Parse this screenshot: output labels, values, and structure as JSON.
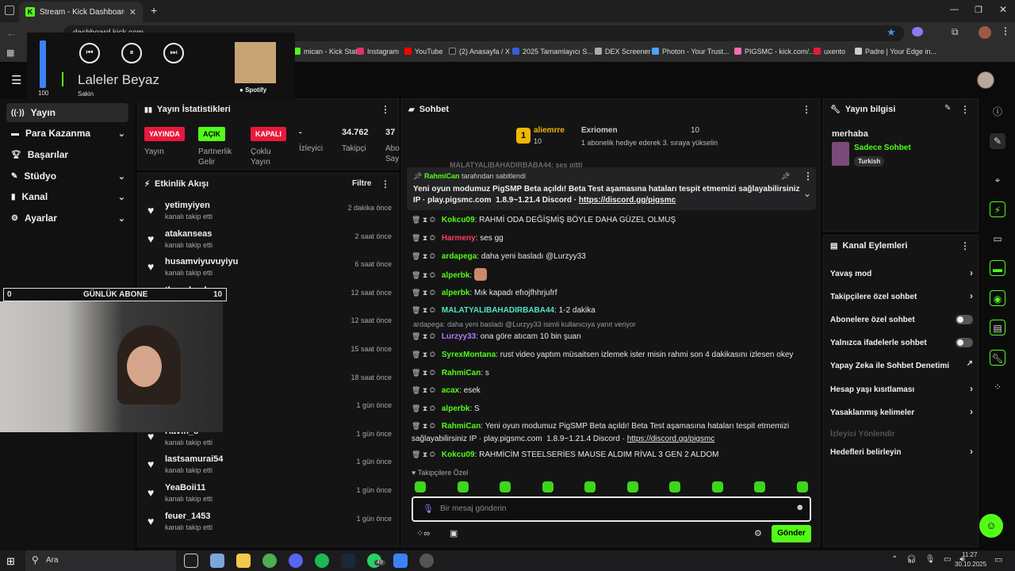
{
  "browser": {
    "tab_title": "Stream - Kick Dashboard",
    "address": "dashboard.kick.com",
    "bookmarks": [
      "mican - Kick Stat...",
      "Instagram",
      "YouTube",
      "(2) Anasayfa / X",
      "2025 Tamamlayıcı S...",
      "DEX Screener",
      "Photon - Your Trust...",
      "PIGSMC - kick.com/...",
      "uxento",
      "Padre | Your Edge in..."
    ]
  },
  "sidebar": {
    "items": [
      {
        "label": "Yayın",
        "active": true
      },
      {
        "label": "Para Kazanma",
        "chevron": true
      },
      {
        "label": "Başarılar"
      },
      {
        "label": "Stüdyo",
        "chevron": true
      },
      {
        "label": "Kanal",
        "chevron": true
      },
      {
        "label": "Ayarlar",
        "chevron": true
      }
    ]
  },
  "stats": {
    "title": "Yayın İstatistikleri",
    "badges": [
      {
        "text": "YAYINDA",
        "color": "#e8193c",
        "label": "Yayın"
      },
      {
        "text": "AÇIK",
        "color": "#53fc18",
        "label": "Partnerlik Gelir"
      },
      {
        "text": "KAPALI",
        "color": "#e8193c",
        "label": "Çoklu Yayın"
      }
    ],
    "numbers": [
      {
        "value": "-",
        "label": "İzleyici"
      },
      {
        "value": "34.762",
        "label": "Takipçi"
      },
      {
        "value": "37",
        "label": "Abo Say"
      }
    ]
  },
  "activity": {
    "title": "Etkinlik Akışı",
    "filter": "Filtre",
    "items": [
      {
        "name": "yetimyiyen",
        "sub": "kanalı takip etti",
        "time": "2 dakika önce"
      },
      {
        "name": "atakanseas",
        "sub": "kanalı takip etti",
        "time": "2 saat önce"
      },
      {
        "name": "husamviyuvuyiyu",
        "sub": "kanalı takip etti",
        "time": "6 saat önce"
      },
      {
        "name": "throwbanlama",
        "sub": "kanalı takip etti",
        "time": "12 saat önce"
      },
      {
        "name": "",
        "sub": "",
        "time": "12 saat önce"
      },
      {
        "name": "7",
        "sub": "",
        "time": "15 saat önce"
      },
      {
        "name": "",
        "sub": "",
        "time": "18 saat önce"
      },
      {
        "name": "",
        "sub": "",
        "time": "1 gün önce"
      },
      {
        "name": "Havin_8",
        "sub": "kanalı takip etti",
        "time": "1 gün önce"
      },
      {
        "name": "lastsamurai54",
        "sub": "kanalı takip etti",
        "time": "1 gün önce"
      },
      {
        "name": "YeaBoii11",
        "sub": "kanalı takip etti",
        "time": "1 gün önce"
      },
      {
        "name": "feuer_1453",
        "sub": "kanalı takip etti",
        "time": "1 gün önce"
      }
    ]
  },
  "chat": {
    "title": "Sohbet",
    "top_user": "aliemrre",
    "top_count": "10",
    "top_rank": "1",
    "exriomen": "Exriomen",
    "exriomen_count": "10",
    "gift_note": "1 abonelik hediye ederek 3. sıraya yükselin",
    "pinned": {
      "by": "RahmiCan",
      "by_suffix": "tarafından sabitlendi",
      "text": "Yeni oyun modumuz PigSMP Beta açıldı! Beta Test aşamasına hataları tespit etmemizi sağlayabilirsiniz IP · play.pigsmc.com",
      "version": "1.8.9~1.21.4 Discord ·",
      "link": "https://discord.gg/pigsmc"
    },
    "faded": "MALATYALIBAHADIRBABA44: ses gitti",
    "messages": [
      {
        "user": "Kokcu09",
        "cls": "g",
        "text": "RAHMİ ODA DEĞİŞMİŞ BÖYLE DAHA GÜZEL OLMUŞ"
      },
      {
        "user": "Harmeny",
        "cls": "r",
        "text": "ses gg"
      },
      {
        "user": "ardapega",
        "cls": "g",
        "text": "daha yeni basladı @Lurzyy33"
      },
      {
        "user": "alperbk",
        "cls": "g",
        "text": ""
      },
      {
        "user": "alperbk",
        "cls": "g",
        "text": "Mık kapadı efıojfhhrjufrf"
      },
      {
        "user": "MALATYALIBAHADIRBABA44",
        "cls": "c",
        "text": "1-2 dakika"
      },
      {
        "user": "Lurzyy33",
        "cls": "p",
        "text": "ona göre atıcam 10 bin şuan"
      },
      {
        "user": "SyrexMontana",
        "cls": "g",
        "text": "rust video yaptım müsaitsen izlemek ister misin rahmi son 4 dakikasını izlesen okey"
      },
      {
        "user": "RahmiCan",
        "cls": "g",
        "text": "s"
      },
      {
        "user": "acax",
        "cls": "g",
        "text": "esek"
      },
      {
        "user": "alperbk",
        "cls": "g",
        "text": "S"
      }
    ],
    "reply_note": "ardapega: daha yeni basladı @Lurzyy33 isimli kullanıcıya yanıt veriyor",
    "long_msg": {
      "user": "RahmiCan",
      "text": "Yeni oyun modumuz PigSMP Beta açıldı! Beta Test aşamasına hataları tespit etmemizi sağlayabilirsiniz IP · play.pigsmc.com",
      "version": "1.8.9~1.21.4 Discord ·",
      "link": "https://discord.gg/pigsmc"
    },
    "last_msg": {
      "user": "Kokcu09",
      "text": "RAHMİCİM STEELSERİES MAUSE ALDIM RİVAL 3 GEN 2 ALDOM"
    },
    "followers_only": "Takipçilere Özel",
    "placeholder": "Bir mesaj gönderin",
    "send": "Gönder"
  },
  "stream_info": {
    "title": "Yayın bilgisi",
    "stream_title": "merhaba",
    "category": "Sadece Sohbet",
    "tag": "Turkish"
  },
  "channel_actions": {
    "title": "Kanal Eylemleri",
    "items": [
      {
        "label": "Yavaş mod",
        "type": "arrow"
      },
      {
        "label": "Takipçilere özel sohbet",
        "type": "arrow"
      },
      {
        "label": "Abonelere özel sohbet",
        "type": "toggle"
      },
      {
        "label": "Yalnızca ifadelerle sohbet",
        "type": "toggle"
      },
      {
        "label": "Yapay Zeka ile Sohbet Denetimi",
        "type": "ext"
      },
      {
        "label": "Hesap yaşı kısıtlaması",
        "type": "arrow"
      },
      {
        "label": "Yasaklanmış kelimeler",
        "type": "arrow"
      },
      {
        "label": "İzleyici Yönlendir",
        "type": "disabled"
      },
      {
        "label": "Hedefleri belirleyin",
        "type": "arrow"
      }
    ]
  },
  "player": {
    "volume": "100",
    "song": "Laleler Beyaz",
    "artist": "Sakin",
    "brand": "Spotify"
  },
  "goal": {
    "left": "0",
    "text": "GÜNLÜK ABONE",
    "right": "10"
  },
  "taskbar": {
    "search": "Ara",
    "time": "11:27",
    "date": "30.10.2025",
    "whatsapp_badge": "49"
  }
}
